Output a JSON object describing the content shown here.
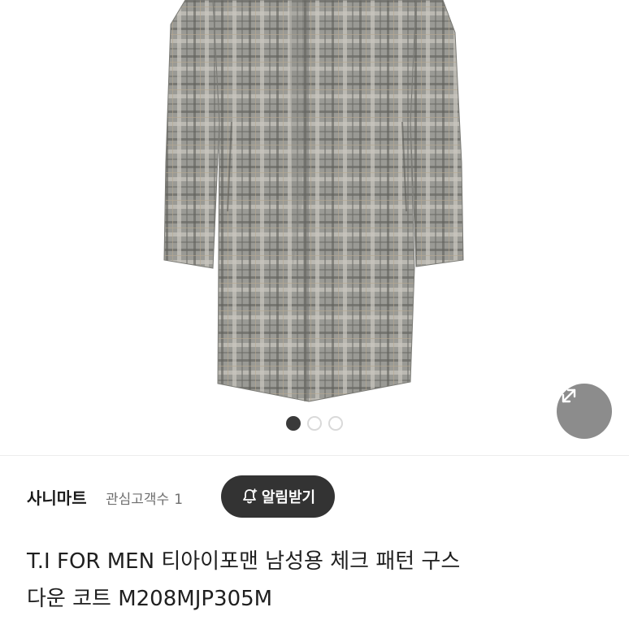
{
  "product_image": {
    "alt": "",
    "pattern_color": "#8c8c88",
    "carousel": {
      "total": 3,
      "active": 1
    }
  },
  "expand_button": {
    "icon": "expand-diagonal-icon"
  },
  "seller": {
    "name": "사니마트",
    "followers_label": "관심고객수",
    "followers_count": "1",
    "notify_label": "알림받기",
    "notify_icon": "bell-plus-icon"
  },
  "product": {
    "title_line1": "T.I FOR MEN 티아이포맨 남성용 체크 패턴 구스",
    "title_line2": "다운 코트 M208MJP305M"
  },
  "colors": {
    "button_dark": "#333333",
    "text_primary": "#1f1f1f",
    "text_secondary": "#6f6f6f"
  }
}
